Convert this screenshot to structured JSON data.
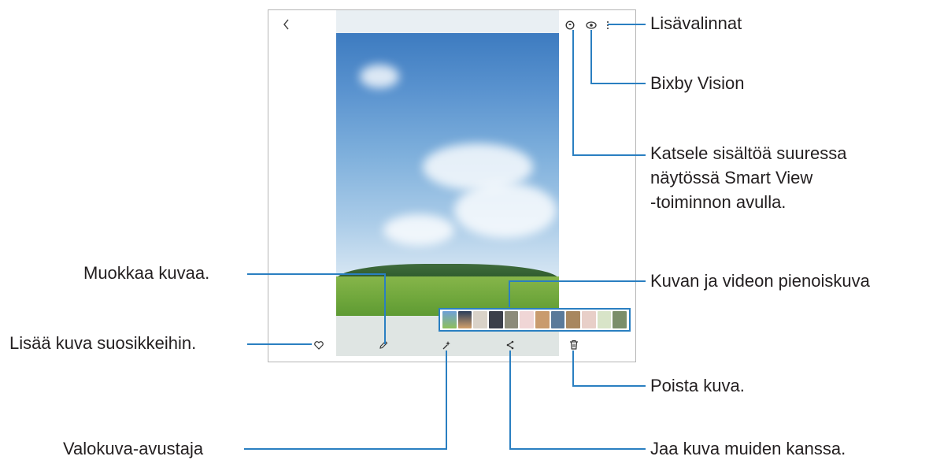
{
  "labels": {
    "more_options": "Lisävalinnat",
    "bixby_vision": "Bixby Vision",
    "smart_view_1": "Katsele sisältöä suuressa",
    "smart_view_2": "näytössä Smart View",
    "smart_view_3": "-toiminnon avulla.",
    "thumbnails": "Kuvan ja videon pienoiskuva",
    "edit": "Muokkaa kuvaa.",
    "favorite": "Lisää kuva suosikkeihin.",
    "delete": "Poista kuva.",
    "assistant": "Valokuva-avustaja",
    "share": "Jaa kuva muiden kanssa."
  },
  "colors": {
    "callout_line": "#2a7fc1",
    "thumbnail_strip_border": "#2a7fc1"
  },
  "icons": {
    "back": "chevron-left-icon",
    "smart_view": "smart-view-icon",
    "bixby": "eye-icon",
    "more": "more-vertical-icon",
    "favorite": "heart-icon",
    "edit": "pencil-icon",
    "assistant": "sparkle-icon",
    "share": "share-icon",
    "delete": "trash-icon"
  }
}
